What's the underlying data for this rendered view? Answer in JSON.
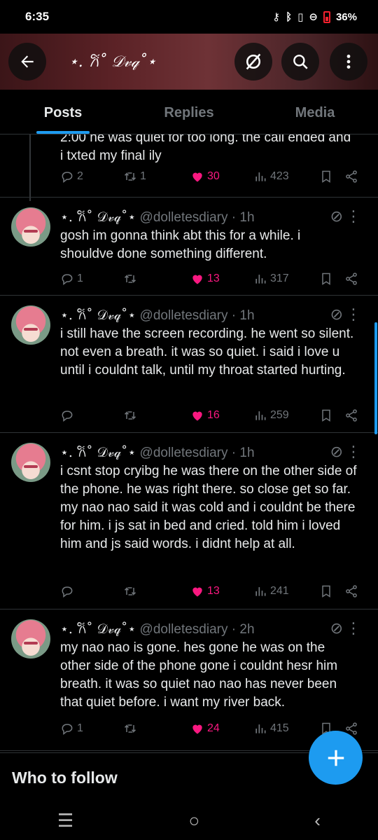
{
  "status": {
    "time": "6:35",
    "battery": "36%"
  },
  "header": {
    "title": "⋆. 𐙚˚ 𝒟𝓋𝓆˚⋆"
  },
  "tabs": [
    {
      "label": "Posts",
      "active": true
    },
    {
      "label": "Replies",
      "active": false
    },
    {
      "label": "Media",
      "active": false
    }
  ],
  "tweets": [
    {
      "name": "",
      "handle": "",
      "time": "",
      "text": "2:00 he was quiet for too long. the call ended and i txted my final ily",
      "replies": "2",
      "retweets": "1",
      "likes": "30",
      "views": "423",
      "liked": true
    },
    {
      "name": "⋆. 𐙚˚ 𝒟𝓋𝓆˚⋆",
      "handle": "@dolletesdiary",
      "time": "· 1h",
      "text": "gosh im gonna think abt this for a while. i shouldve done something different.",
      "replies": "1",
      "retweets": "",
      "likes": "13",
      "views": "317",
      "liked": true
    },
    {
      "name": "⋆. 𐙚˚ 𝒟𝓋𝓆˚⋆",
      "handle": "@dolletesdiary",
      "time": "· 1h",
      "text": "i still have the screen recording. he went so silent. not even a breath. it was so quiet. i said i love u until i couldnt talk, until my throat started hurting.",
      "replies": "",
      "retweets": "",
      "likes": "16",
      "views": "259",
      "liked": true
    },
    {
      "name": "⋆. 𐙚˚ 𝒟𝓋𝓆˚⋆",
      "handle": "@dolletesdiary",
      "time": "· 1h",
      "text": "i csnt stop cryibg he was there on the other side of the phone. he was right there. so close get so far. my nao nao said it was cold and i couldnt be there for him. i js sat in bed and cried. told him i loved him and js said words. i didnt help at all.",
      "replies": "",
      "retweets": "",
      "likes": "13",
      "views": "241",
      "liked": true
    },
    {
      "name": "⋆. 𐙚˚ 𝒟𝓋𝓆˚⋆",
      "handle": "@dolletesdiary",
      "time": "· 2h",
      "text": "my nao nao is gone. hes gone he was on the other side of the phone gone i couldnt hesr him breath. it was so quiet nao nao has never been that quiet before. i want my river back.",
      "replies": "1",
      "retweets": "",
      "likes": "24",
      "views": "415",
      "liked": true
    }
  ],
  "who_to_follow": {
    "title": "Who to follow"
  },
  "icons": {
    "back": "arrow-left-icon",
    "grok": "grok-icon",
    "search": "search-icon",
    "more": "more-vertical-icon",
    "reply": "reply-icon",
    "retweet": "retweet-icon",
    "like": "heart-icon",
    "views": "views-icon",
    "bookmark": "bookmark-icon",
    "share": "share-icon",
    "compose": "plus-icon"
  },
  "colors": {
    "accent": "#1d9bf0",
    "like": "#f91880",
    "muted": "#71767b"
  }
}
